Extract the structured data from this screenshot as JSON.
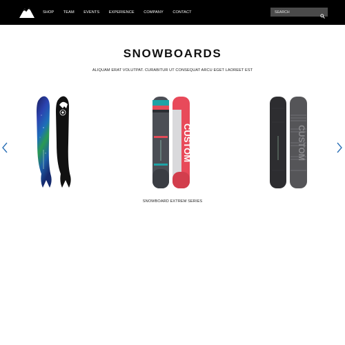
{
  "header": {
    "logo": "mountain-logo",
    "nav": [
      "SHOP",
      "TEAM",
      "EVENTS",
      "EXPERIENCE",
      "COMPANY",
      "CONTACT"
    ],
    "search": {
      "placeholder": "SEARCH",
      "value": "",
      "icon": "search-icon"
    }
  },
  "main": {
    "title": "SNOWBOARDS",
    "subtitle": "ALIQUAM ERAT VOLUTPAT. CURABITUR UT CONSEQUAT ARCU EGET LAOREET EST",
    "caption": "SNOWBOARD EXTREM SERIES"
  },
  "carousel": {
    "prev_icon": "chevron-left-icon",
    "next_icon": "chevron-right-icon",
    "accent": "#2a6fb5"
  },
  "products": [
    {
      "name": "galaxy-swallowtail",
      "colors": [
        "#1a2a8a",
        "#2d9a4a",
        "#111111"
      ]
    },
    {
      "name": "red-grey-graphic",
      "colors": [
        "#4a4d52",
        "#e84a5a",
        "#1aa3a6"
      ]
    },
    {
      "name": "dark-grey-stripes",
      "colors": [
        "#2c2c2e",
        "#6b6b6e",
        "#1a1a1a"
      ]
    }
  ]
}
